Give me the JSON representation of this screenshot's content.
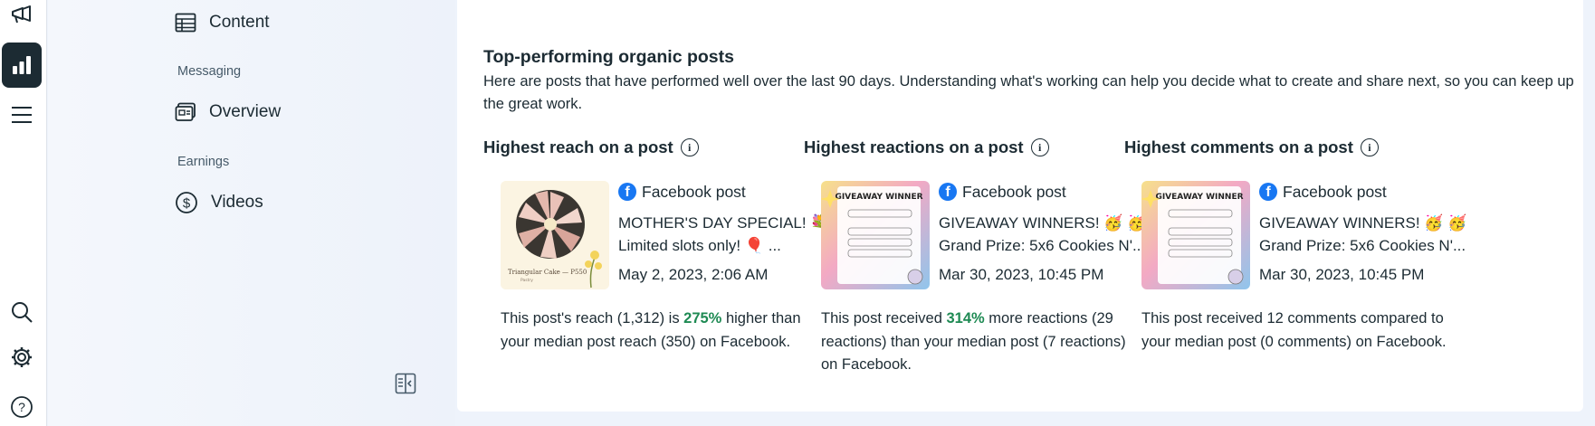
{
  "left_rail": {
    "icons": [
      "megaphone-icon",
      "bar-chart-icon",
      "menu-icon",
      "search-icon",
      "gear-icon",
      "help-icon"
    ],
    "active_color": "#1c2b33"
  },
  "sidebar": {
    "items": [
      {
        "label": "Content",
        "icon": "table-icon"
      },
      {
        "section": "Messaging"
      },
      {
        "label": "Overview",
        "icon": "inbox-icon"
      },
      {
        "section": "Earnings"
      },
      {
        "label": "Videos",
        "icon": "dollar-icon"
      }
    ]
  },
  "main": {
    "title": "Top-performing organic posts",
    "description": "Here are posts that have performed well over the last 90 days. Understanding what's working can help you decide what to create and share next, so you can keep up the great work.",
    "columns": [
      {
        "title": "Highest reach on a post",
        "post_type": "Facebook post",
        "line1": "MOTHER'S DAY SPECIAL! 💐",
        "line2": "Limited slots only! 🎈 ...",
        "date": "May 2, 2023, 2:06 AM",
        "thumb_caption": "Triangular Cake — P550",
        "summary_before": "This post's reach (1,312) is ",
        "summary_pct": "275%",
        "summary_after": " higher than your median post reach (350) on Facebook."
      },
      {
        "title": "Highest reactions on a post",
        "post_type": "Facebook post",
        "line1": "GIVEAWAY WINNERS! 🥳 🥳",
        "line2": "Grand Prize: 5x6 Cookies N'...",
        "date": "Mar 30, 2023, 10:45 PM",
        "thumb_caption": "GIVEAWAY WINNER",
        "summary_before": "This post received ",
        "summary_pct": "314%",
        "summary_after": " more reactions (29 reactions) than your median post (7 reactions) on Facebook."
      },
      {
        "title": "Highest comments on a post",
        "post_type": "Facebook post",
        "line1": "GIVEAWAY WINNERS! 🥳 🥳",
        "line2": "Grand Prize: 5x6 Cookies N'...",
        "date": "Mar 30, 2023, 10:45 PM",
        "thumb_caption": "GIVEAWAY WINNER",
        "summary_before": "This post received 12 comments compared to your median post (0 comments) on Facebook.",
        "summary_pct": "",
        "summary_after": ""
      }
    ],
    "highlight_color": "#1e8a53",
    "facebook_color": "#1877f2"
  }
}
